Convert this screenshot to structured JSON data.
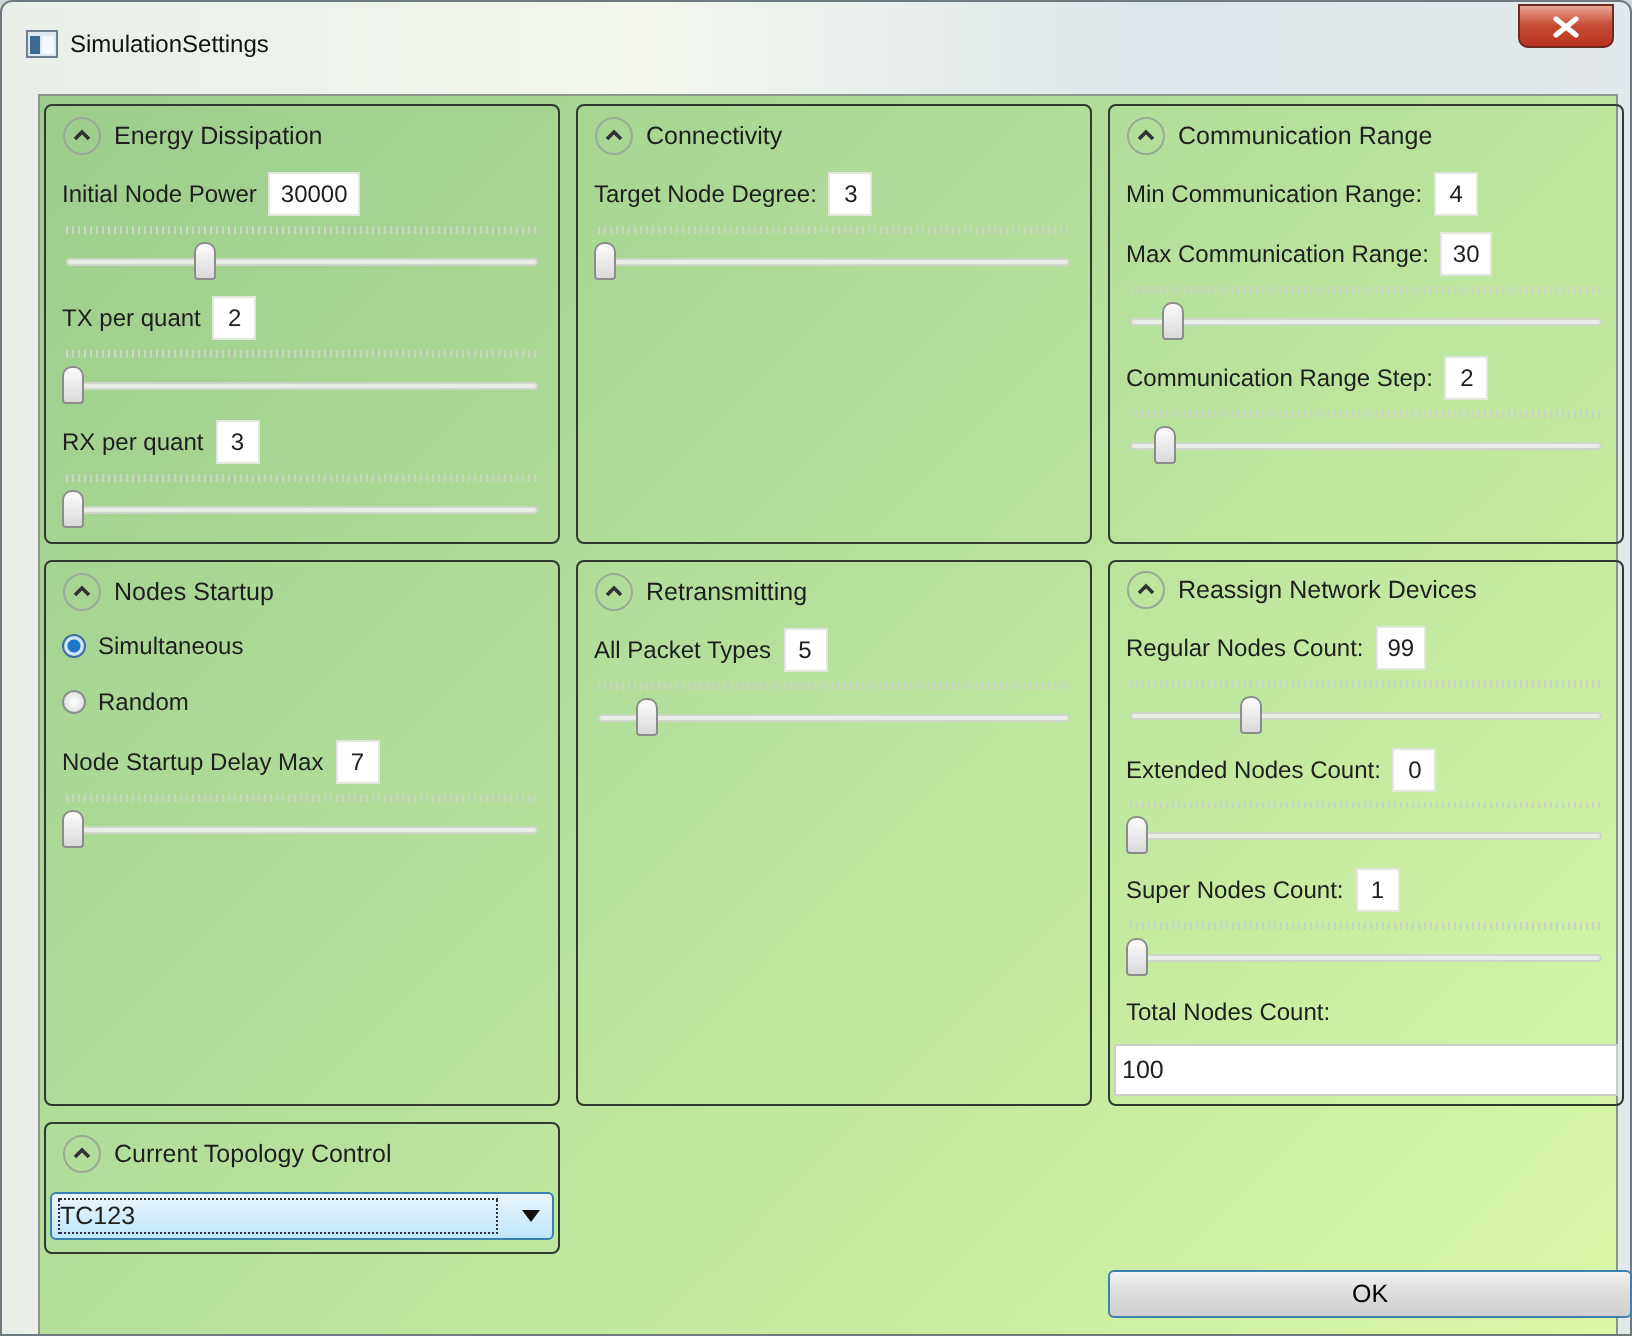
{
  "window": {
    "title": "SimulationSettings"
  },
  "groups": [
    {
      "title": "Energy Dissipation",
      "expanded": true,
      "items": [
        {
          "kind": "slider",
          "label": "Initial Node Power",
          "value": "30000",
          "level": 0.29
        },
        {
          "kind": "slider",
          "label": "TX per quant",
          "value": "2",
          "level": 0
        },
        {
          "kind": "slider",
          "label": "RX per quant",
          "value": "3",
          "level": 0
        }
      ]
    },
    {
      "title": "Connectivity",
      "expanded": true,
      "items": [
        {
          "kind": "slider",
          "label": "Target Node Degree:",
          "value": "3",
          "level": 0
        }
      ]
    },
    {
      "title": "Communication Range",
      "expanded": true,
      "items": [
        {
          "kind": "value",
          "label": "Min Communication Range:",
          "value": "4"
        },
        {
          "kind": "slider",
          "label": "Max Communication Range:",
          "value": "30",
          "level": 0.08
        },
        {
          "kind": "slider",
          "label": "Communication Range Step:",
          "value": "2",
          "level": 0.06
        }
      ]
    },
    {
      "title": "Nodes Startup",
      "expanded": true,
      "items": [
        {
          "kind": "radio",
          "label": "Simultaneous",
          "selected": true
        },
        {
          "kind": "radio",
          "label": "Random",
          "selected": false
        },
        {
          "kind": "slider",
          "label": "Node Startup Delay Max",
          "value": "7",
          "level": 0
        }
      ]
    },
    {
      "title": "Retransmitting",
      "expanded": true,
      "items": [
        {
          "kind": "slider",
          "label": "All Packet Types",
          "value": "5",
          "level": 0.09
        }
      ]
    },
    {
      "title": "Reassign Network Devices",
      "expanded": true,
      "items": [
        {
          "kind": "slider",
          "label": "Regular Nodes Count:",
          "value": "99",
          "level": 0.25
        },
        {
          "kind": "slider",
          "label": "Extended Nodes Count:",
          "value": "0",
          "level": 0
        },
        {
          "kind": "slider",
          "label": "Super Nodes Count:",
          "value": "1",
          "level": 0
        },
        {
          "kind": "field",
          "label": "Total Nodes Count:",
          "value": "100"
        }
      ]
    },
    {
      "title": "Current Topology Control",
      "expanded": true,
      "items": [
        {
          "kind": "dropdown",
          "value": "TC123"
        }
      ]
    }
  ],
  "ok_button": "OK"
}
